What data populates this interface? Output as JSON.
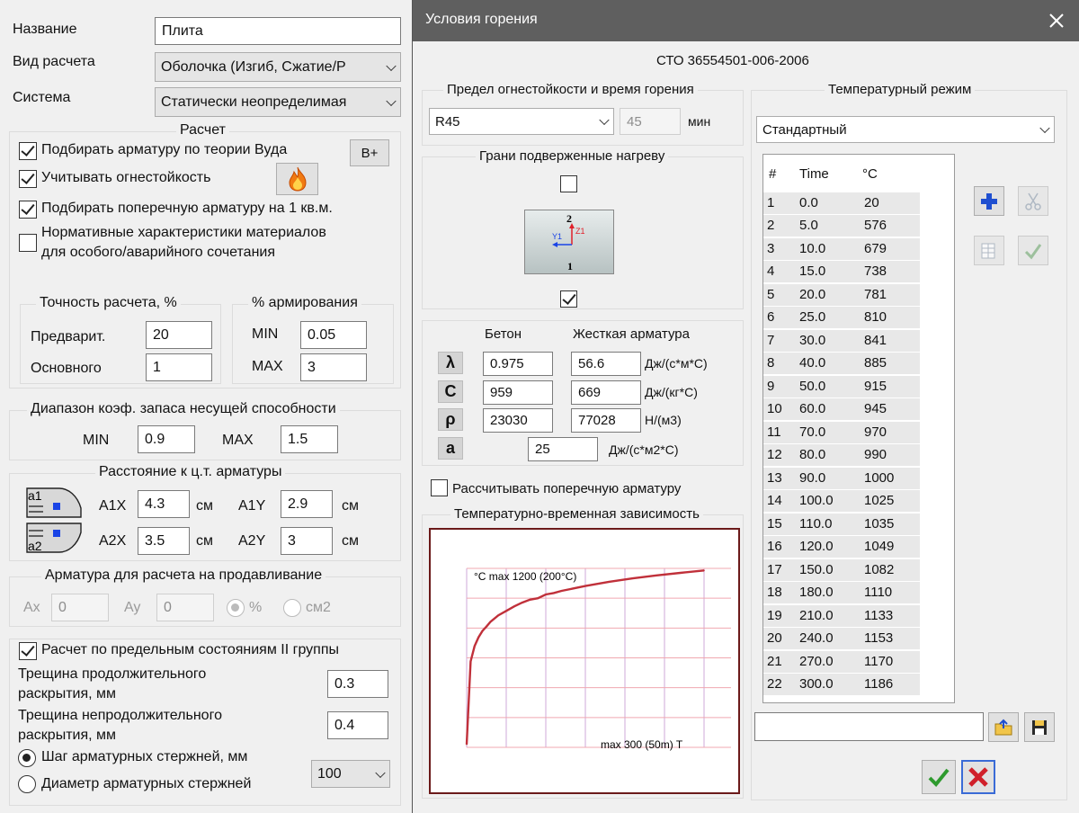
{
  "left": {
    "name_label": "Название",
    "name_value": "Плита",
    "calc_type_label": "Вид расчета",
    "calc_type_value": "Оболочка (Изгиб, Сжатие/Р",
    "system_label": "Система",
    "system_value": "Статически неопределимая",
    "calc_group": "Расчет",
    "cb_wood": "Подбирать арматуру по теории Вуда",
    "wood_button": "B+",
    "cb_fire": "Учитывать огнестойкость",
    "cb_transverse": "Подбирать поперечную арматуру на 1 кв.м.",
    "cb_special_1": "Нормативные характеристики материалов",
    "cb_special_2": "для особого/аварийного сочетания",
    "precision_group": "Точность расчета, %",
    "prelim_label": "Предварит.",
    "prelim_value": "20",
    "main_label": "Основного",
    "main_value": "1",
    "reinf_group": "% армирования",
    "min_label": "MIN",
    "min_value": "0.05",
    "max_label": "MAX",
    "max_value": "3",
    "range_group": "Диапазон коэф. запаса несущей способности",
    "range_min_label": "MIN",
    "range_min_value": "0.9",
    "range_max_label": "MAX",
    "range_max_value": "1.5",
    "distance_group": "Расстояние к ц.т. арматуры",
    "a1x_label": "A1X",
    "a1x_value": "4.3",
    "a1y_label": "A1Y",
    "a1y_value": "2.9",
    "a2x_label": "A2X",
    "a2x_value": "3.5",
    "a2y_label": "A2Y",
    "a2y_value": "3",
    "unit_cm": "см",
    "icon_a1": "a1",
    "icon_a2": "a2",
    "punch_group": "Арматура для расчета на продавливание",
    "ax_label": "Ax",
    "ax_value": "0",
    "ay_label": "Ay",
    "ay_value": "0",
    "percent_label": "%",
    "cm2_label": "см2",
    "cb_limit": "Расчет по предельным состояниям II группы",
    "crack_long_1": "Трещина продолжительного",
    "crack_long_2": "раскрытия, мм",
    "crack_long_value": "0.3",
    "crack_short_1": "Трещина непродолжительного",
    "crack_short_2": "раскрытия, мм",
    "crack_short_value": "0.4",
    "rb_step": "Шаг арматурных стержней, мм",
    "rb_diameter": "Диаметр арматурных стержней",
    "step_value": "100"
  },
  "dialog": {
    "title": "Условия горения",
    "standard": "СТО 36554501-006-2006",
    "fire_group": "Предел огнестойкости и время горения",
    "fire_select": "R45",
    "fire_minutes": "45",
    "min_unit": "мин",
    "faces_group": "Грани подверженные нагреву",
    "face_top_label": "2",
    "face_bottom_label": "1",
    "axis_y": "Y1",
    "axis_z": "Z1",
    "concrete_header": "Бетон",
    "rigid_header": "Жесткая арматура",
    "lambda_sym": "λ",
    "lambda_concrete": "0.975",
    "lambda_rigid": "56.6",
    "lambda_unit": "Дж/(с*м*С)",
    "c_sym": "C",
    "c_concrete": "959",
    "c_rigid": "669",
    "c_unit": "Дж/(кг*С)",
    "rho_sym": "ρ",
    "rho_concrete": "23030",
    "rho_rigid": "77028",
    "rho_unit": "Н/(м3)",
    "a_sym": "a",
    "a_value": "25",
    "a_unit": "Дж/(с*м2*С)",
    "cb_transverse": "Рассчитывать поперечную арматуру",
    "chart_group": "Температурно-временная зависимость",
    "temp_group": "Температурный режим",
    "temp_select": "Стандартный",
    "table_headers": [
      "#",
      "Time",
      "°C"
    ]
  },
  "chart_data": {
    "type": "line",
    "title": "",
    "ylabel": "°C max 1200 (200°C)",
    "xlabel": "max 300 (50m) T",
    "xlim": [
      0,
      300
    ],
    "ylim": [
      0,
      1200
    ],
    "grid": true,
    "series": [
      {
        "x": [
          0,
          5,
          10,
          15,
          20,
          25,
          30,
          40,
          50,
          60,
          70,
          80,
          90,
          100,
          110,
          120,
          150,
          180,
          210,
          240,
          270,
          300
        ],
        "values": [
          20,
          576,
          679,
          738,
          781,
          810,
          841,
          885,
          915,
          945,
          970,
          990,
          1000,
          1025,
          1035,
          1049,
          1082,
          1110,
          1133,
          1153,
          1170,
          1186
        ]
      }
    ],
    "colors": {
      "line": "#c0303a",
      "grid": "#cfa8d8",
      "grid_h": "#f0a8b0",
      "frame": "#6b1a1a"
    }
  }
}
